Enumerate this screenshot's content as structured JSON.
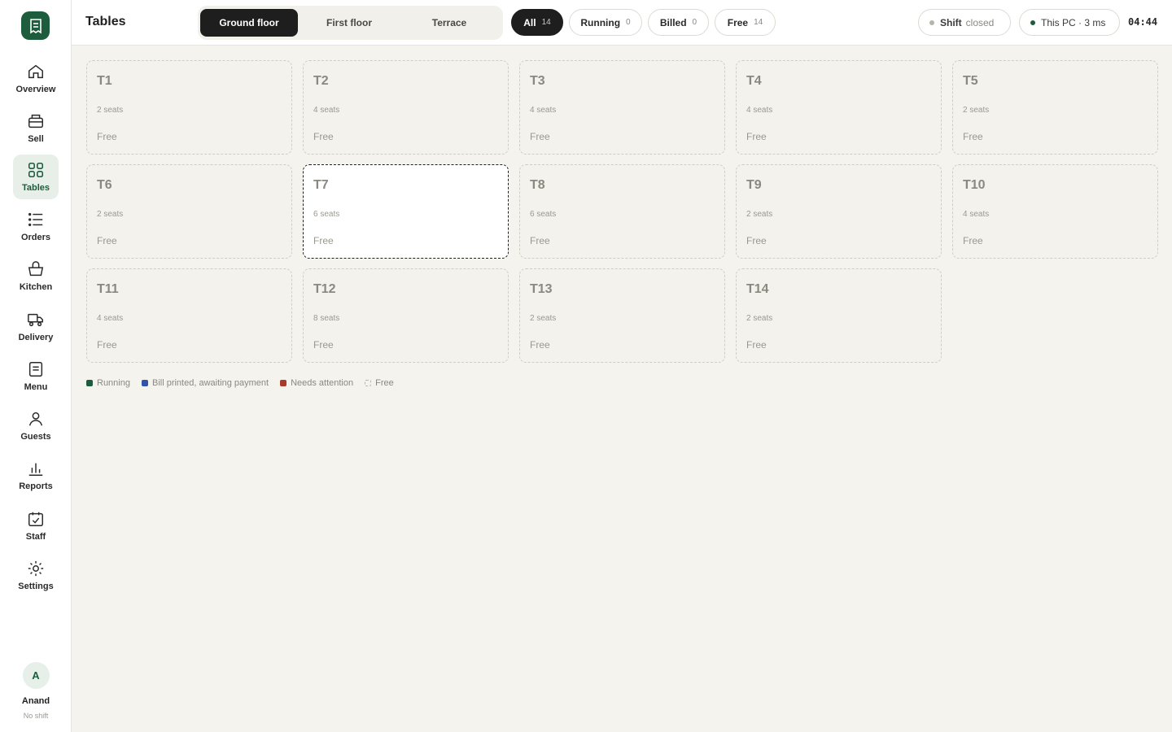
{
  "sidebar": {
    "brand_icon": "receipt-icon",
    "items": [
      {
        "label": "Overview",
        "icon": "home-icon"
      },
      {
        "label": "Sell",
        "icon": "register-icon"
      },
      {
        "label": "Tables",
        "icon": "grid-icon",
        "active": true
      },
      {
        "label": "Orders",
        "icon": "list-icon"
      },
      {
        "label": "Kitchen",
        "icon": "basket-icon"
      },
      {
        "label": "Delivery",
        "icon": "truck-icon"
      },
      {
        "label": "Menu",
        "icon": "menu-doc-icon"
      },
      {
        "label": "Guests",
        "icon": "person-icon"
      },
      {
        "label": "Reports",
        "icon": "bar-chart-icon"
      },
      {
        "label": "Staff",
        "icon": "calendar-check-icon"
      },
      {
        "label": "Settings",
        "icon": "gear-icon"
      }
    ],
    "user": {
      "initial": "A",
      "name": "Anand",
      "status": "No shift"
    }
  },
  "header": {
    "title": "Tables",
    "floor_tabs": [
      {
        "label": "Ground floor",
        "active": true
      },
      {
        "label": "First floor"
      },
      {
        "label": "Terrace"
      }
    ],
    "filters": [
      {
        "label": "All",
        "count": "14",
        "active": true
      },
      {
        "label": "Running",
        "count": "0"
      },
      {
        "label": "Billed",
        "count": "0"
      },
      {
        "label": "Free",
        "count": "14"
      }
    ],
    "shift": {
      "label": "Shift",
      "state": "closed"
    },
    "connection": {
      "text": "This PC · 3 ms"
    },
    "clock": "04:44"
  },
  "tables": [
    {
      "name": "T1",
      "seats": "2 seats",
      "status": "Free"
    },
    {
      "name": "T2",
      "seats": "4 seats",
      "status": "Free"
    },
    {
      "name": "T3",
      "seats": "4 seats",
      "status": "Free"
    },
    {
      "name": "T4",
      "seats": "4 seats",
      "status": "Free"
    },
    {
      "name": "T5",
      "seats": "2 seats",
      "status": "Free"
    },
    {
      "name": "T6",
      "seats": "2 seats",
      "status": "Free"
    },
    {
      "name": "T7",
      "seats": "6 seats",
      "status": "Free",
      "selected": true
    },
    {
      "name": "T8",
      "seats": "6 seats",
      "status": "Free"
    },
    {
      "name": "T9",
      "seats": "2 seats",
      "status": "Free"
    },
    {
      "name": "T10",
      "seats": "4 seats",
      "status": "Free"
    },
    {
      "name": "T11",
      "seats": "4 seats",
      "status": "Free"
    },
    {
      "name": "T12",
      "seats": "8 seats",
      "status": "Free"
    },
    {
      "name": "T13",
      "seats": "2 seats",
      "status": "Free"
    },
    {
      "name": "T14",
      "seats": "2 seats",
      "status": "Free"
    }
  ],
  "legend": [
    {
      "label": "Running",
      "color": "#1d5c3c"
    },
    {
      "label": "Bill printed, awaiting payment",
      "color": "#2f55a4"
    },
    {
      "label": "Needs attention",
      "color": "#a8392b"
    },
    {
      "label": "Free",
      "color": "free"
    }
  ],
  "colors": {
    "accent": "#1d5c3c",
    "active_dark": "#1e1e1e",
    "status_dot_closed": "#b5b3ab",
    "status_dot_online": "#1d5c3c"
  }
}
